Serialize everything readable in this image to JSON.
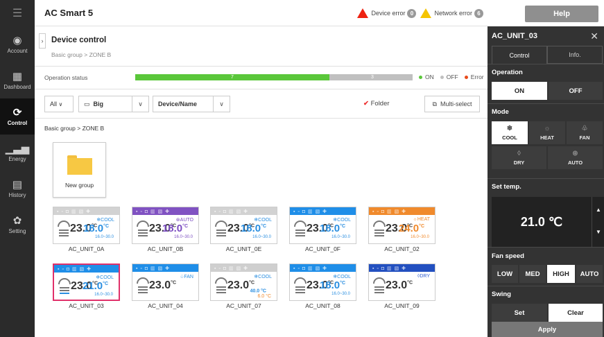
{
  "app": {
    "title": "AC Smart 5"
  },
  "errors": {
    "device_label": "Device error",
    "device_count": "0",
    "network_label": "Network error",
    "network_count": "6",
    "help": "Help"
  },
  "nav": [
    {
      "label": "Account",
      "icon": "account-icon"
    },
    {
      "label": "Dashboard",
      "icon": "dashboard-icon"
    },
    {
      "label": "Control",
      "icon": "control-icon"
    },
    {
      "label": "Energy",
      "icon": "energy-icon"
    },
    {
      "label": "History",
      "icon": "history-icon"
    },
    {
      "label": "Setting",
      "icon": "setting-icon"
    }
  ],
  "header": {
    "title": "Device control",
    "crumb": "Basic group  >  ZONE B"
  },
  "status": {
    "label": "Operation status",
    "on_count": "7",
    "off_count": "3",
    "on_fraction": 0.7,
    "legend_on": "ON",
    "legend_off": "OFF",
    "legend_error": "Error",
    "on_color": "#5ac73a",
    "off_color": "#c0c0c0",
    "error_color": "#e84a1a"
  },
  "toolbar": {
    "filter": "All",
    "size": "Big",
    "sort": "Device/Name",
    "folder": "Folder",
    "multi": "Multi-select"
  },
  "path": "Basic group > ZONE B",
  "new_group": "New group",
  "units": [
    {
      "name": "AC_UNIT_0A",
      "temp": "23.0",
      "unit": "°C",
      "mode": "COOL",
      "mode_icon": "snowflake-icon",
      "set": "18.0",
      "set_unit": "°C",
      "range": "16.0~30.0",
      "color": "#d2d2d2",
      "mode_color": "#2a8ee0"
    },
    {
      "name": "AC_UNIT_0B",
      "temp": "23.0",
      "unit": "°C",
      "mode": "AUTO",
      "mode_icon": "auto-icon",
      "set": "18.0",
      "set_unit": "°C",
      "range": "16.0~30.0",
      "color": "#8052c2",
      "mode_color": "#7a4cc0"
    },
    {
      "name": "AC_UNIT_0E",
      "temp": "23.0",
      "unit": "°C",
      "mode": "COOL",
      "mode_icon": "snowflake-icon",
      "set": "18.0",
      "set_unit": "°C",
      "range": "16.0~30.0",
      "color": "#d2d2d2",
      "mode_color": "#2a8ee0"
    },
    {
      "name": "AC_UNIT_0F",
      "temp": "23.0",
      "unit": "°C",
      "mode": "COOL",
      "mode_icon": "snowflake-icon",
      "set": "18.0",
      "set_unit": "°C",
      "range": "16.0~30.0",
      "color": "#1f8ee8",
      "mode_color": "#2a8ee0"
    },
    {
      "name": "AC_UNIT_02",
      "temp": "23.0",
      "unit": "°C",
      "mode": "HEAT",
      "mode_icon": "sun-icon",
      "set": "24.0",
      "set_unit": "°C",
      "range": "16.0~30.0",
      "color": "#f08a2c",
      "mode_color": "#f08a2c"
    },
    {
      "name": "AC_UNIT_03",
      "temp": "23.0",
      "unit": "°C",
      "mode": "COOL",
      "mode_icon": "snowflake-icon",
      "set": "21.0",
      "set_unit": "°C",
      "range": "16.0~30.0",
      "color": "#1f8ee8",
      "mode_color": "#2a8ee0"
    },
    {
      "name": "AC_UNIT_04",
      "temp": "23.0",
      "unit": "°C",
      "mode": "FAN",
      "mode_icon": "fan-icon",
      "set": "",
      "set_unit": "",
      "range": "",
      "color": "#1f8ee8",
      "mode_color": "#2a8ee0"
    },
    {
      "name": "AC_UNIT_07",
      "temp": "23.0",
      "unit": "°C",
      "mode": "COOL",
      "mode_icon": "snowflake-icon",
      "set": "40.0 °C",
      "set_unit": "",
      "range": "6.0 °C",
      "color": "#cfcfcf",
      "mode_color": "#2a8ee0"
    },
    {
      "name": "AC_UNIT_08",
      "temp": "23.0",
      "unit": "°C",
      "mode": "COOL",
      "mode_icon": "snowflake-icon",
      "set": "18.0",
      "set_unit": "°C",
      "range": "16.0~30.0",
      "color": "#1f8ee8",
      "mode_color": "#2a8ee0"
    },
    {
      "name": "AC_UNIT_09",
      "temp": "23.0",
      "unit": "°C",
      "mode": "DRY",
      "mode_icon": "drop-icon",
      "set": "",
      "set_unit": "",
      "range": "",
      "color": "#2350c0",
      "mode_color": "#2a5ad0"
    }
  ],
  "panel": {
    "title": "AC_UNIT_03",
    "tab_control": "Control",
    "tab_info": "Info.",
    "operation": "Operation",
    "on": "ON",
    "off": "OFF",
    "mode": "Mode",
    "cool": "COOL",
    "heat": "HEAT",
    "fan": "FAN",
    "dry": "DRY",
    "auto": "AUTO",
    "settemp": "Set temp.",
    "temp": "21.0 ℃",
    "fanspeed": "Fan speed",
    "low": "LOW",
    "med": "MED",
    "high": "HIGH",
    "fauto": "AUTO",
    "swing": "Swing",
    "set": "Set",
    "clear": "Clear",
    "apply": "Apply"
  }
}
